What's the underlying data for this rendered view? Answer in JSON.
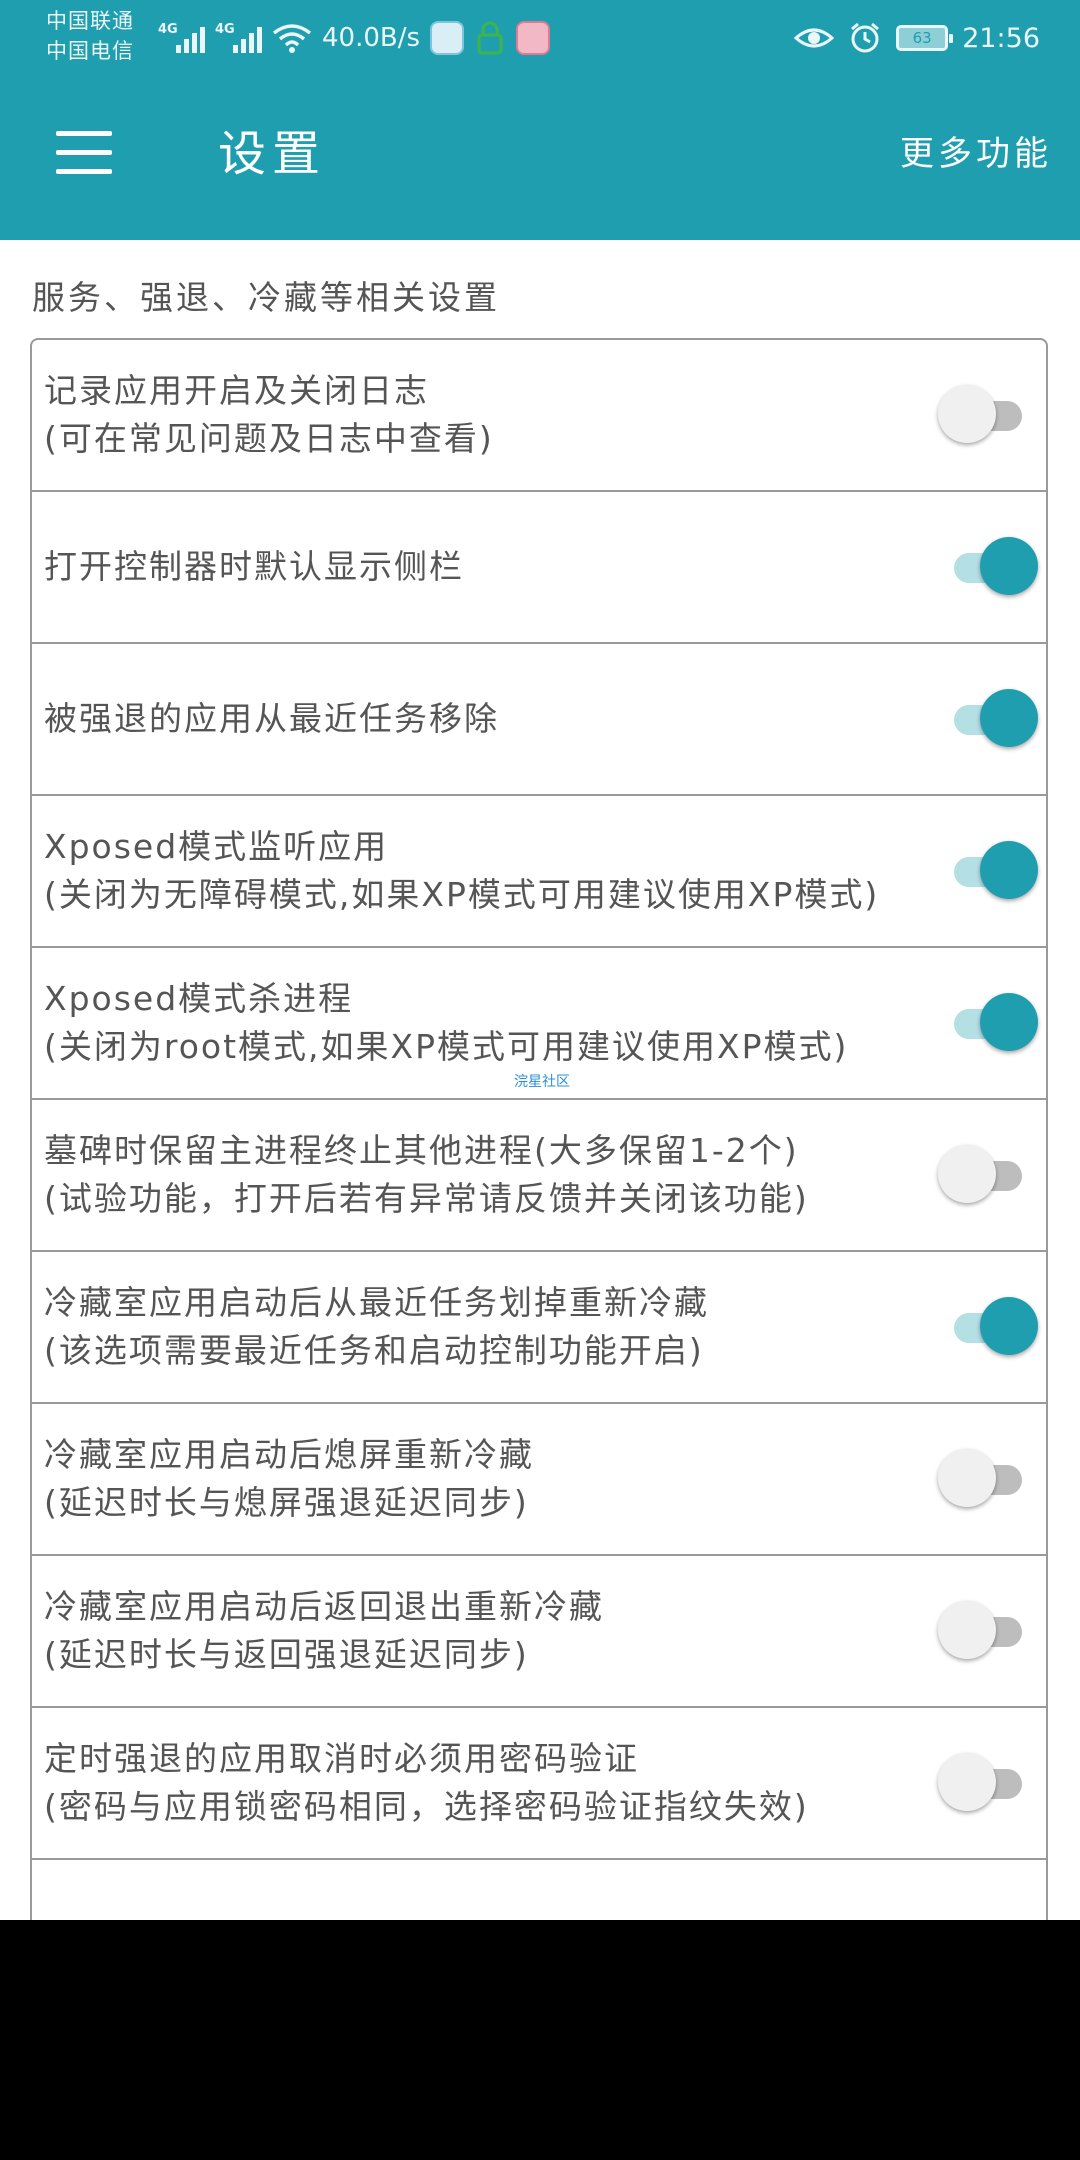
{
  "status_bar": {
    "carrier_1": "中国联通",
    "carrier_2": "中国电信",
    "network_1": "4G",
    "network_2": "4G",
    "speed": "40.0B/s",
    "battery": "63",
    "time": "21:56"
  },
  "toolbar": {
    "title": "设置",
    "more_label": "更多功能"
  },
  "section": {
    "header": "服务、强退、冷藏等相关设置"
  },
  "settings": [
    {
      "label": "记录应用开启及关闭日志",
      "sub": "(可在常见问题及日志中查看)",
      "on": false
    },
    {
      "label": "打开控制器时默认显示侧栏",
      "sub": "",
      "on": true
    },
    {
      "label": "被强退的应用从最近任务移除",
      "sub": "",
      "on": true
    },
    {
      "label": "Xposed模式监听应用",
      "sub": "(关闭为无障碍模式,如果XP模式可用建议使用XP模式)",
      "on": true
    },
    {
      "label": "Xposed模式杀进程",
      "sub": "(关闭为root模式,如果XP模式可用建议使用XP模式)",
      "on": true
    },
    {
      "label": "墓碑时保留主进程终止其他进程(大多保留1-2个)",
      "sub": "(试验功能，打开后若有异常请反馈并关闭该功能)",
      "on": false
    },
    {
      "label": "冷藏室应用启动后从最近任务划掉重新冷藏",
      "sub": "(该选项需要最近任务和启动控制功能开启)",
      "on": true
    },
    {
      "label": "冷藏室应用启动后熄屏重新冷藏",
      "sub": "(延迟时长与熄屏强退延迟同步)",
      "on": false
    },
    {
      "label": "冷藏室应用启动后返回退出重新冷藏",
      "sub": "(延迟时长与返回强退延迟同步)",
      "on": false
    },
    {
      "label": "定时强退的应用取消时必须用密码验证",
      "sub": "(密码与应用锁密码相同，选择密码验证指纹失效)",
      "on": false
    }
  ],
  "watermark": "浣星社区",
  "colors": {
    "accent": "#1f9eb0",
    "accent_light": "#b3dfe5",
    "text": "#555555",
    "border": "#9a9a9a"
  }
}
